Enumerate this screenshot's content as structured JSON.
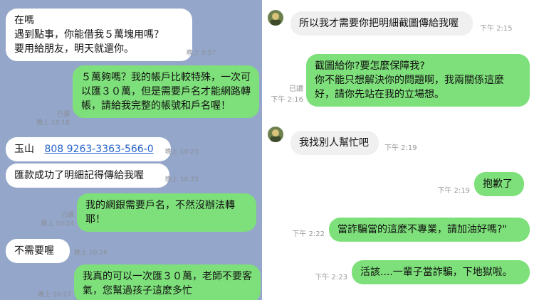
{
  "colors": {
    "left_bg": "#94a6c9",
    "out_bubble": "#7ee07a",
    "in_bubble_left": "#ffffff",
    "in_bubble_right": "#f0f0f0",
    "link": "#2563c9"
  },
  "left_chat": {
    "messages": [
      {
        "text": "在嗎\n遇到點事，你能借我５萬塊用嗎？\n要用給朋友，明天就還你。",
        "time": "晚上 9:57"
      },
      {
        "text": "５萬夠嗎？我的帳戶比較特殊，一次可以匯３０萬，但是需要戶名才能網路轉帳，請給我完整的帳號和戶名喔！",
        "read": "已讀",
        "time": "晚上 10:18"
      },
      {
        "bank": "玉山",
        "account": "808  9263-3363-566-0",
        "time": "晚上 10:23"
      },
      {
        "text": "匯款成功了明細記得傳給我喔",
        "time": "晚上 10:23"
      },
      {
        "text": "我的網銀需要戶名，不然沒辦法轉耶！",
        "read": "已讀",
        "time": "晚上 10:24"
      },
      {
        "text": "不需要喔",
        "time": "晚上 10:26"
      },
      {
        "text": "我真的可以一次匯３０萬，老師不要客氣，您幫過孩子這麼多忙",
        "time": "晚上 10:27"
      }
    ]
  },
  "right_chat": {
    "messages": [
      {
        "text": "所以我才需要你把明細截圖傳給我喔",
        "time": "下午 2:15"
      },
      {
        "text": "截圖給你?要怎麼保障我?\n你不能只想解決你的問題啊，我兩關係這麼好，請你先站在我的立場想。",
        "read": "已讀",
        "time": "下午 2:16"
      },
      {
        "text": "我找別人幫忙吧",
        "time": "下午 2:19"
      },
      {
        "text": "抱歉了",
        "time": "下午 2:19"
      },
      {
        "text": "當詐騙當的這麼不專業，請加油好嗎?\"",
        "time": "下午 2:22"
      },
      {
        "text": "活該....一輩子當詐騙，下地獄啦。",
        "time": "下午 2:23"
      }
    ]
  }
}
